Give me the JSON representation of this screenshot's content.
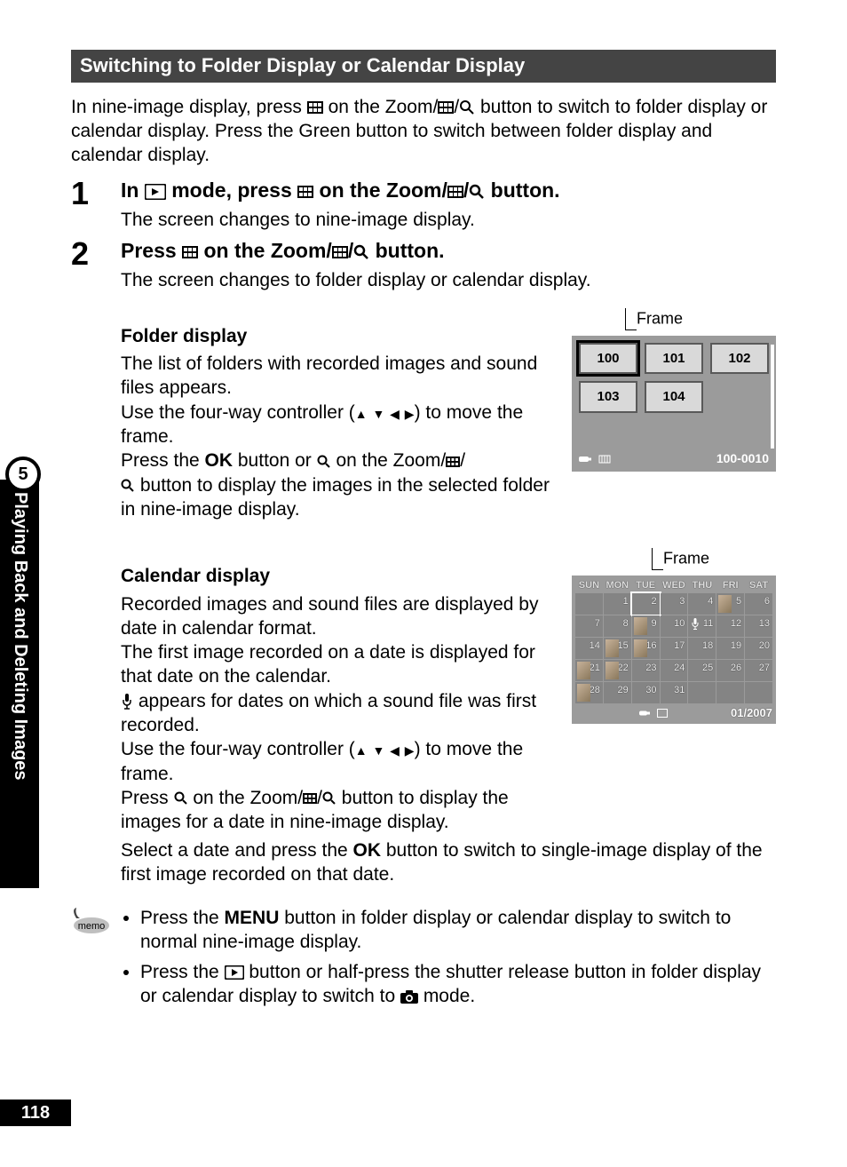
{
  "page_number": "118",
  "section_number": "5",
  "sidebar_text": "Playing Back and Deleting Images",
  "heading": "Switching to Folder Display or Calendar Display",
  "intro": "In nine-image display, press    on the Zoom/ /  button to switch to folder display or calendar display. Press the Green button to switch between folder display and calendar display.",
  "step1": {
    "num": "1",
    "head_pre": "In ",
    "head_mid": " mode, press ",
    "head_post": " on the Zoom/",
    "head_end": " button.",
    "sub": "The screen changes to nine-image display."
  },
  "step2": {
    "num": "2",
    "head_pre": "Press ",
    "head_mid": " on the Zoom/",
    "head_end": " button.",
    "sub": "The screen changes to folder display or calendar display."
  },
  "folder": {
    "title": "Folder display",
    "p1": "The list of folders with recorded images and sound files appears.",
    "p2_pre": "Use the four-way controller (",
    "p2_post": ") to move the frame.",
    "p3_pre": "Press the ",
    "p3_ok": "OK",
    "p3_mid": " button or ",
    "p3_post": " on the Zoom/",
    "p3_end": " button to display the images in the selected folder in nine-image display.",
    "frame_label": "Frame",
    "cells": [
      "100",
      "101",
      "102",
      "103",
      "104",
      ""
    ],
    "status": "100-0010"
  },
  "calendar": {
    "title": "Calendar display",
    "p1": "Recorded images and sound files are displayed by date in calendar format.",
    "p2": "The first image recorded on a date is displayed for that date on the calendar.",
    "p3_pre": "",
    "p3": " appears for dates on which a sound file was first recorded.",
    "p4_pre": "Use the four-way controller (",
    "p4_post": ") to move the frame.",
    "p5_pre": "Press ",
    "p5_mid": " on the Zoom/",
    "p5_end": " button to display the images for a date in nine-image display.",
    "p6_pre": "Select a date and press the ",
    "p6_ok": "OK",
    "p6_post": " button to switch to single-image display of the first image recorded on that date.",
    "frame_label": "Frame",
    "days": [
      "SUN",
      "MON",
      "TUE",
      "WED",
      "THU",
      "FRI",
      "SAT"
    ],
    "footer": "01/2007",
    "grid": [
      [
        "",
        "1",
        "2",
        "3",
        "4",
        "5",
        "6"
      ],
      [
        "7",
        "8",
        "9",
        "10",
        "11",
        "12",
        "13"
      ],
      [
        "14",
        "15",
        "16",
        "17",
        "18",
        "19",
        "20"
      ],
      [
        "21",
        "22",
        "23",
        "24",
        "25",
        "26",
        "27"
      ],
      [
        "28",
        "29",
        "30",
        "31",
        "",
        "",
        ""
      ]
    ]
  },
  "memo": {
    "b1_pre": "Press the ",
    "b1_menu": "MENU",
    "b1_post": " button in folder display or calendar display to switch to normal nine-image display.",
    "b2_pre": "Press the ",
    "b2_mid": " button or half-press the shutter release button in folder display or calendar display to switch to ",
    "b2_post": " mode."
  }
}
